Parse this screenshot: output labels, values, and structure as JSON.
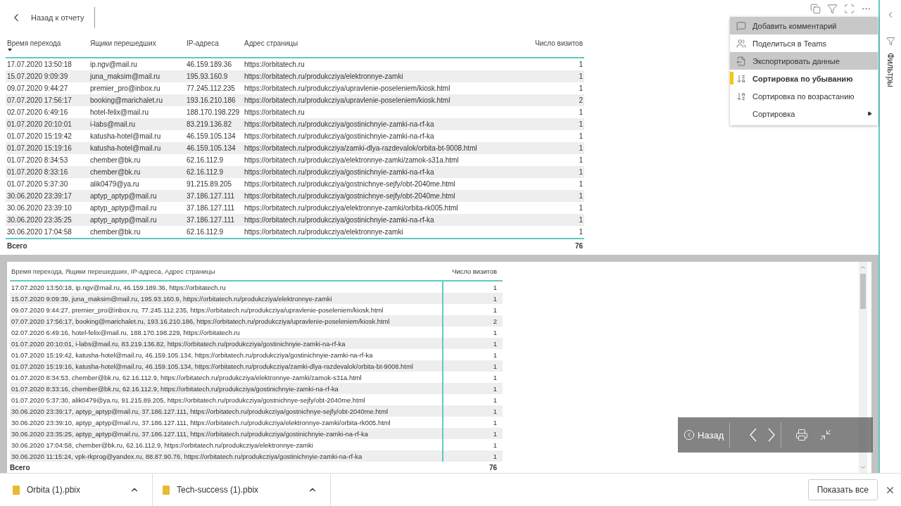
{
  "back_button": {
    "label": "Назад к отчету"
  },
  "top_table": {
    "columns": [
      {
        "label": "Время перехода",
        "sorted": true
      },
      {
        "label": "Ящики перешедших",
        "sorted": false
      },
      {
        "label": "IP-адреса",
        "sorted": false
      },
      {
        "label": "Адрес страницы",
        "sorted": false
      },
      {
        "label": "Число визитов",
        "sorted": false
      }
    ],
    "rows": [
      [
        "17.07.2020 13:50:18",
        "ip.ngv@mail.ru",
        "46.159.189.36",
        "https://orbitatech.ru",
        "1"
      ],
      [
        "15.07.2020 9:09:39",
        "juna_maksim@mail.ru",
        "195.93.160.9",
        "https://orbitatech.ru/produkcziya/elektronnye-zamki",
        "1"
      ],
      [
        "09.07.2020 9:44:27",
        "premier_pro@inbox.ru",
        "77.245.112.235",
        "https://orbitatech.ru/produkcziya/upravlenie-poseleniem/kiosk.html",
        "1"
      ],
      [
        "07.07.2020 17:56:17",
        "booking@marichalet.ru",
        "193.16.210.186",
        "https://orbitatech.ru/produkcziya/upravlenie-poseleniem/kiosk.html",
        "2"
      ],
      [
        "02.07.2020 6:49:16",
        "hotel-felix@mail.ru",
        "188.170.198.229",
        "https://orbitatech.ru",
        "1"
      ],
      [
        "01.07.2020 20:10:01",
        "i-labs@mail.ru",
        "83.219.136.82",
        "https://orbitatech.ru/produkcziya/gostinichnyie-zamki-na-rf-ka",
        "1"
      ],
      [
        "01.07.2020 15:19:42",
        "katusha-hotel@mail.ru",
        "46.159.105.134",
        "https://orbitatech.ru/produkcziya/gostinichnyie-zamki-na-rf-ka",
        "1"
      ],
      [
        "01.07.2020 15:19:16",
        "katusha-hotel@mail.ru",
        "46.159.105.134",
        "https://orbitatech.ru/produkcziya/zamki-dlya-razdevalok/orbita-bt-9008.html",
        "1"
      ],
      [
        "01.07.2020 8:34:53",
        "chember@bk.ru",
        "62.16.112.9",
        "https://orbitatech.ru/produkcziya/elektronnye-zamki/zamok-s31a.html",
        "1"
      ],
      [
        "01.07.2020 8:33:16",
        "chember@bk.ru",
        "62.16.112.9",
        "https://orbitatech.ru/produkcziya/gostinichnyie-zamki-na-rf-ka",
        "1"
      ],
      [
        "01.07.2020 5:37:30",
        "alik0479@ya.ru",
        "91.215.89.205",
        "https://orbitatech.ru/produkcziya/gostnichnye-sejfy/obt-2040me.html",
        "1"
      ],
      [
        "30.06.2020 23:39:17",
        "aptyp_aptyp@mail.ru",
        "37.186.127.111",
        "https://orbitatech.ru/produkcziya/gostnichnye-sejfy/obt-2040me.html",
        "1"
      ],
      [
        "30.06.2020 23:39:10",
        "aptyp_aptyp@mail.ru",
        "37.186.127.111",
        "https://orbitatech.ru/produkcziya/elektronnye-zamki/orbita-rk005.html",
        "1"
      ],
      [
        "30.06.2020 23:35:25",
        "aptyp_aptyp@mail.ru",
        "37.186.127.111",
        "https://orbitatech.ru/produkcziya/gostinichnyie-zamki-na-rf-ka",
        "1"
      ],
      [
        "30.06.2020 17:04:58",
        "chember@bk.ru",
        "62.16.112.9",
        "https://orbitatech.ru/produkcziya/elektronnye-zamki",
        "1"
      ]
    ],
    "total_label": "Всего",
    "total": "76"
  },
  "bottom_table": {
    "columns": [
      "Время перехода, Ящики перешедших, IP-адреса, Адрес страницы",
      "Число визитов"
    ],
    "rows": [
      [
        "17.07.2020 13:50:18, ip.ngv@mail.ru, 46.159.189.36, https://orbitatech.ru",
        "1"
      ],
      [
        "15.07.2020 9:09:39, juna_maksim@mail.ru, 195.93.160.9, https://orbitatech.ru/produkcziya/elektronnye-zamki",
        "1"
      ],
      [
        "09.07.2020 9:44:27, premier_pro@inbox.ru, 77.245.112.235, https://orbitatech.ru/produkcziya/upravlenie-poseleniem/kiosk.html",
        "1"
      ],
      [
        "07.07.2020 17:56:17, booking@marichalet.ru, 193.16.210.186, https://orbitatech.ru/produkcziya/upravlenie-poseleniem/kiosk.html",
        "2"
      ],
      [
        "02.07.2020 6:49:16, hotel-felix@mail.ru, 188.170.198.229, https://orbitatech.ru",
        "1"
      ],
      [
        "01.07.2020 20:10:01, i-labs@mail.ru, 83.219.136.82, https://orbitatech.ru/produkcziya/gostinichnyie-zamki-na-rf-ka",
        "1"
      ],
      [
        "01.07.2020 15:19:42, katusha-hotel@mail.ru, 46.159.105.134, https://orbitatech.ru/produkcziya/gostinichnyie-zamki-na-rf-ka",
        "1"
      ],
      [
        "01.07.2020 15:19:16, katusha-hotel@mail.ru, 46.159.105.134, https://orbitatech.ru/produkcziya/zamki-dlya-razdevalok/orbita-bt-9008.html",
        "1"
      ],
      [
        "01.07.2020 8:34:53, chember@bk.ru, 62.16.112.9, https://orbitatech.ru/produkcziya/elektronnye-zamki/zamok-s31a.html",
        "1"
      ],
      [
        "01.07.2020 8:33:16, chember@bk.ru, 62.16.112.9, https://orbitatech.ru/produkcziya/gostinichnyie-zamki-na-rf-ka",
        "1"
      ],
      [
        "01.07.2020 5:37:30, alik0479@ya.ru, 91.215.89.205, https://orbitatech.ru/produkcziya/gostnichnye-sejfy/obt-2040me.html",
        "1"
      ],
      [
        "30.06.2020 23:39:17, aptyp_aptyp@mail.ru, 37.186.127.111, https://orbitatech.ru/produkcziya/gostnichnye-sejfy/obt-2040me.html",
        "1"
      ],
      [
        "30.06.2020 23:39:10, aptyp_aptyp@mail.ru, 37.186.127.111, https://orbitatech.ru/produkcziya/elektronnye-zamki/orbita-rk005.html",
        "1"
      ],
      [
        "30.06.2020 23:35:25, aptyp_aptyp@mail.ru, 37.186.127.111, https://orbitatech.ru/produkcziya/gostinichnyie-zamki-na-rf-ka",
        "1"
      ],
      [
        "30.06.2020 17:04:58, chember@bk.ru, 62.16.112.9, https://orbitatech.ru/produkcziya/elektronnye-zamki",
        "1"
      ],
      [
        "30.06.2020 11:15:24, vpk-rkprog@yandex.ru, 88.87.90.76, https://orbitatech.ru/produkcziya/gostinichnyie-zamki-na-rf-ka",
        "1"
      ]
    ],
    "total_label": "Всего",
    "total": "76"
  },
  "context_menu": [
    {
      "label": "Добавить комментарий",
      "highlighted": true,
      "selected": false,
      "submenu": false
    },
    {
      "label": "Поделиться в Teams",
      "highlighted": false,
      "selected": false,
      "submenu": false
    },
    {
      "label": "Экспортировать данные",
      "highlighted": true,
      "selected": false,
      "submenu": false
    },
    {
      "label": "Сортировка по убыванию",
      "highlighted": false,
      "selected": true,
      "submenu": false
    },
    {
      "label": "Сортировка по возрастанию",
      "highlighted": false,
      "selected": false,
      "submenu": false
    },
    {
      "label": "Сортировка",
      "highlighted": false,
      "selected": false,
      "submenu": true
    }
  ],
  "filters_pane": {
    "title": "Фильтры"
  },
  "page_nav": {
    "back": "Назад"
  },
  "downloads": {
    "items": [
      "Orbita (1).pbix",
      "Tech-success (1).pbix"
    ],
    "show_all": "Показать все"
  }
}
